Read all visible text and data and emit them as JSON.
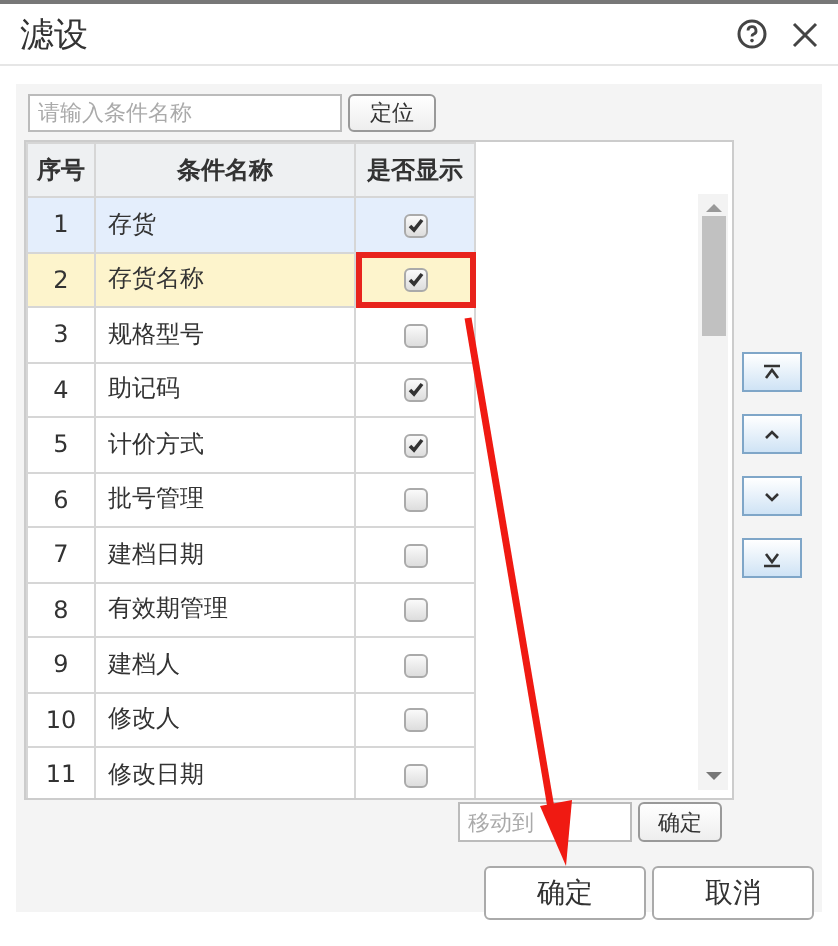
{
  "window": {
    "title": "滤设"
  },
  "search": {
    "placeholder": "请输入条件名称",
    "button": "定位"
  },
  "table": {
    "columns": [
      "序号",
      "条件名称",
      "是否显示"
    ],
    "rows": [
      {
        "index": "1",
        "name": "存货",
        "checked": true,
        "selected": true,
        "current": false,
        "marked": false
      },
      {
        "index": "2",
        "name": "存货名称",
        "checked": true,
        "selected": false,
        "current": true,
        "marked": true
      },
      {
        "index": "3",
        "name": "规格型号",
        "checked": false,
        "selected": false,
        "current": false,
        "marked": false
      },
      {
        "index": "4",
        "name": "助记码",
        "checked": true,
        "selected": false,
        "current": false,
        "marked": false
      },
      {
        "index": "5",
        "name": "计价方式",
        "checked": true,
        "selected": false,
        "current": false,
        "marked": false
      },
      {
        "index": "6",
        "name": "批号管理",
        "checked": false,
        "selected": false,
        "current": false,
        "marked": false
      },
      {
        "index": "7",
        "name": "建档日期",
        "checked": false,
        "selected": false,
        "current": false,
        "marked": false
      },
      {
        "index": "8",
        "name": "有效期管理",
        "checked": false,
        "selected": false,
        "current": false,
        "marked": false
      },
      {
        "index": "9",
        "name": "建档人",
        "checked": false,
        "selected": false,
        "current": false,
        "marked": false
      },
      {
        "index": "10",
        "name": "修改人",
        "checked": false,
        "selected": false,
        "current": false,
        "marked": false
      },
      {
        "index": "11",
        "name": "修改日期",
        "checked": false,
        "selected": false,
        "current": false,
        "marked": false
      }
    ]
  },
  "move_buttons": [
    {
      "kind": "top"
    },
    {
      "kind": "up"
    },
    {
      "kind": "down"
    },
    {
      "kind": "bottom"
    }
  ],
  "move_to": {
    "placeholder": "移动到",
    "button": "确定"
  },
  "buttons": [
    "确定",
    "取消"
  ]
}
